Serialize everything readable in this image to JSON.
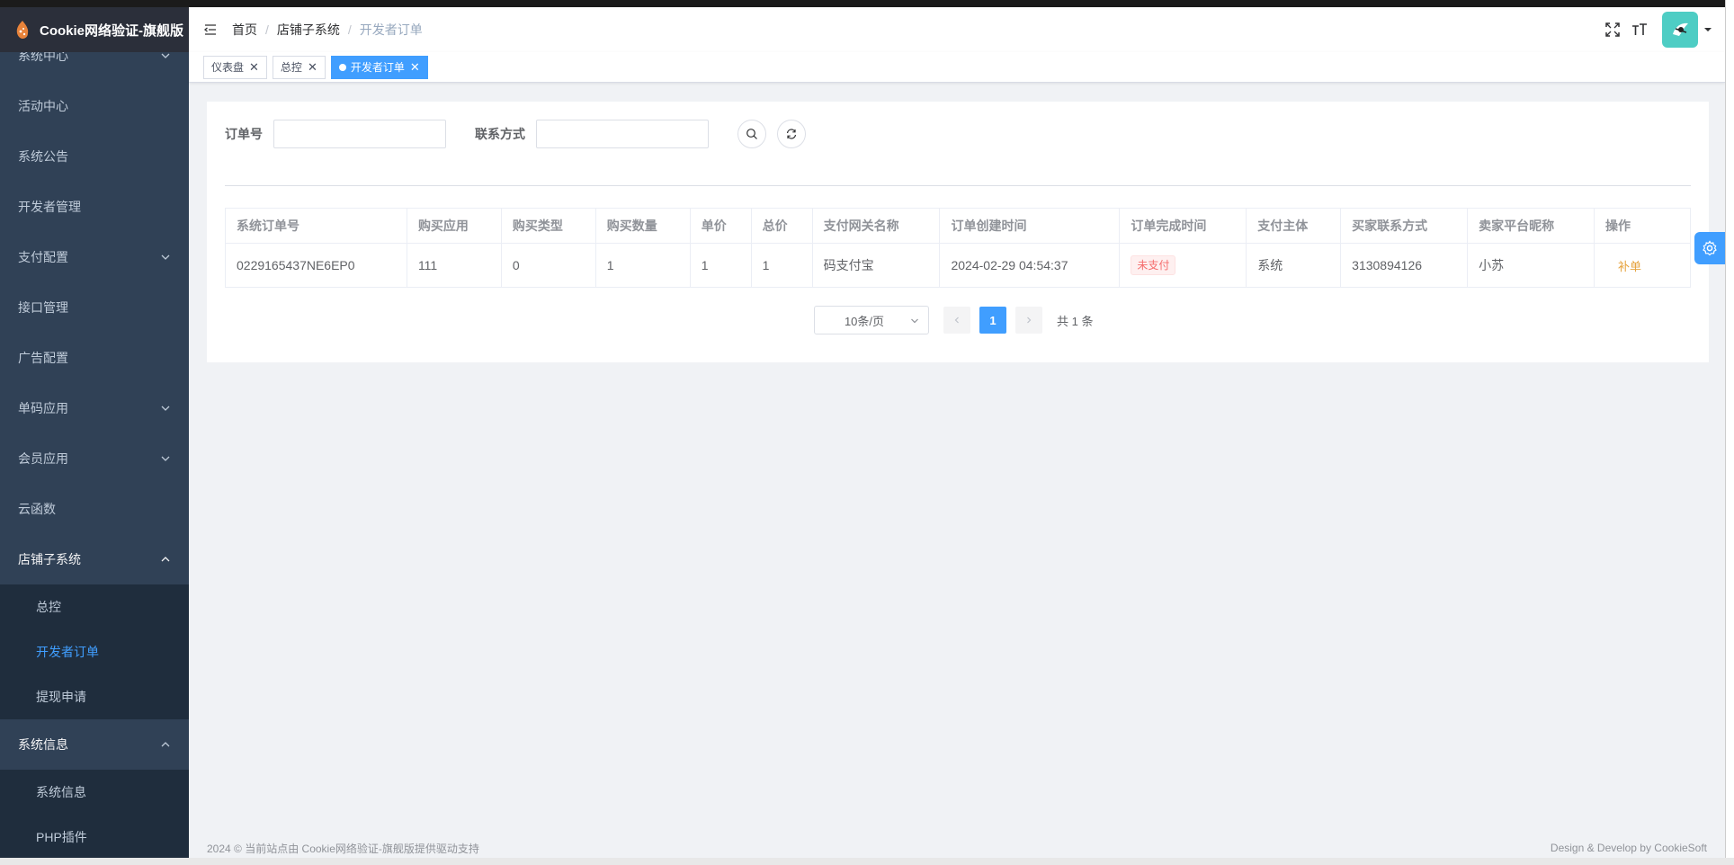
{
  "app": {
    "title": "Cookie网络验证-旗舰版"
  },
  "sidebar": {
    "items": [
      {
        "label": "系统中心",
        "has_children": true
      },
      {
        "label": "活动中心"
      },
      {
        "label": "系统公告"
      },
      {
        "label": "开发者管理"
      },
      {
        "label": "支付配置",
        "has_children": true
      },
      {
        "label": "接口管理"
      },
      {
        "label": "广告配置"
      },
      {
        "label": "单码应用",
        "has_children": true
      },
      {
        "label": "会员应用",
        "has_children": true
      },
      {
        "label": "云函数"
      },
      {
        "label": "店铺子系统",
        "open": true,
        "children": [
          {
            "label": "总控"
          },
          {
            "label": "开发者订单",
            "active": true
          },
          {
            "label": "提现申请"
          }
        ]
      },
      {
        "label": "系统信息",
        "open": true,
        "children": [
          {
            "label": "系统信息"
          },
          {
            "label": "PHP插件"
          }
        ]
      }
    ]
  },
  "header": {
    "breadcrumb": [
      "首页",
      "店铺子系统",
      "开发者订单"
    ]
  },
  "tags": [
    {
      "label": "仪表盘"
    },
    {
      "label": "总控"
    },
    {
      "label": "开发者订单",
      "active": true
    }
  ],
  "search": {
    "order_label": "订单号",
    "order_value": "",
    "contact_label": "联系方式",
    "contact_value": ""
  },
  "table": {
    "columns": [
      "系统订单号",
      "购买应用",
      "购买类型",
      "购买数量",
      "单价",
      "总价",
      "支付网关名称",
      "订单创建时间",
      "订单完成时间",
      "支付主体",
      "买家联系方式",
      "卖家平台昵称",
      "操作"
    ],
    "rows": [
      {
        "order_no": "0229165437NE6EP0",
        "app": "111",
        "type": "0",
        "qty": "1",
        "unit_price": "1",
        "total": "1",
        "gateway": "码支付宝",
        "created": "2024-02-29 04:54:37",
        "status": "未支付",
        "subject": "系统",
        "buyer_contact": "3130894126",
        "seller_nick": "小苏",
        "action": "补单"
      }
    ]
  },
  "pagination": {
    "page_size": "10条/页",
    "current": "1",
    "total_text": "共 1 条"
  },
  "footer": {
    "left": "2024 © 当前站点由 Cookie网络验证-旗舰版提供驱动支持",
    "right": "Design & Develop by CookieSoft"
  },
  "colors": {
    "accent": "#409eff",
    "sidebar_bg": "#304156",
    "warning": "#e6a23c",
    "danger": "#f56c6c"
  }
}
